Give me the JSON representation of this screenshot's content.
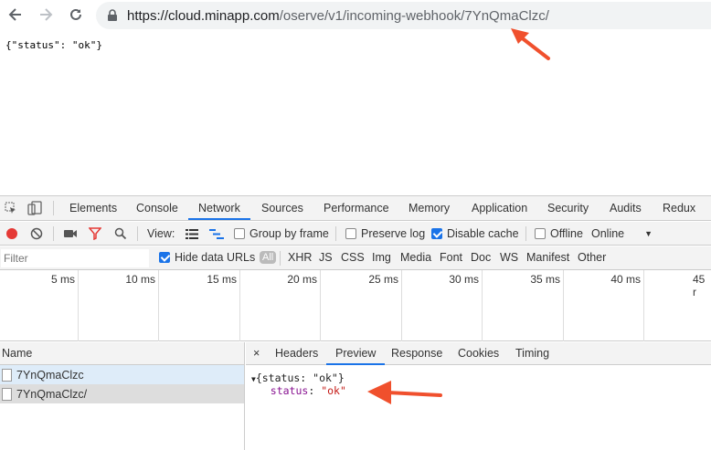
{
  "browser": {
    "url_prefix": "https://cloud.minapp.com",
    "url_path": "/oserve/v1/incoming-webhook/7YnQmaClzc/"
  },
  "page": {
    "body_text": "{\"status\": \"ok\"}"
  },
  "devtools": {
    "tabs": [
      "Elements",
      "Console",
      "Network",
      "Sources",
      "Performance",
      "Memory",
      "Application",
      "Security",
      "Audits",
      "Redux"
    ],
    "active_tab": "Network",
    "toolbar": {
      "view_label": "View:",
      "group_by_frame": "Group by frame",
      "preserve_log": "Preserve log",
      "disable_cache": "Disable cache",
      "offline": "Offline",
      "throttle": "Online"
    },
    "filter": {
      "placeholder": "Filter",
      "hide_data_urls": "Hide data URLs",
      "all": "All",
      "types": [
        "XHR",
        "JS",
        "CSS",
        "Img",
        "Media",
        "Font",
        "Doc",
        "WS",
        "Manifest",
        "Other"
      ]
    },
    "timeline_ticks": [
      "5 ms",
      "10 ms",
      "15 ms",
      "20 ms",
      "25 ms",
      "30 ms",
      "35 ms",
      "40 ms",
      "45 r"
    ],
    "requests": {
      "header": "Name",
      "rows": [
        "7YnQmaClzc",
        "7YnQmaClzc/"
      ]
    },
    "detail": {
      "close": "×",
      "tabs": [
        "Headers",
        "Preview",
        "Response",
        "Cookies",
        "Timing"
      ],
      "active_tab": "Preview",
      "preview_summary": "{status: \"ok\"}",
      "preview_key": "status",
      "preview_value": "\"ok\""
    }
  },
  "colors": {
    "accent": "#1a73e8",
    "annotation_arrow": "#f0502d"
  }
}
